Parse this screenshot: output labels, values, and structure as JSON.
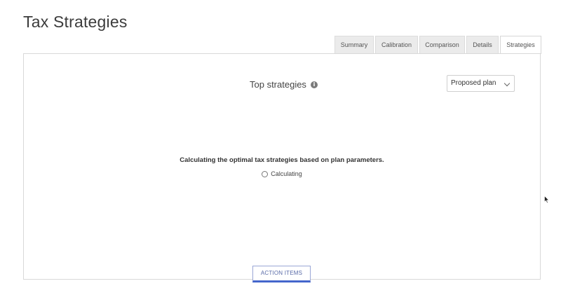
{
  "header": {
    "title": "Tax Strategies"
  },
  "tabs": [
    {
      "label": "Summary",
      "active": false
    },
    {
      "label": "Calibration",
      "active": false
    },
    {
      "label": "Comparison",
      "active": false
    },
    {
      "label": "Details",
      "active": false
    },
    {
      "label": "Strategies",
      "active": true
    }
  ],
  "main": {
    "section_title": "Top strategies",
    "info_icon": "info-icon",
    "plan_select": {
      "value": "Proposed plan"
    },
    "calculating_message": "Calculating the optimal tax strategies based on plan parameters.",
    "status_text": "Calculating"
  },
  "footer": {
    "action_button": "ACTION ITEMS"
  },
  "colors": {
    "accent": "#4466cc",
    "tab_inactive_bg": "#ebebeb"
  }
}
